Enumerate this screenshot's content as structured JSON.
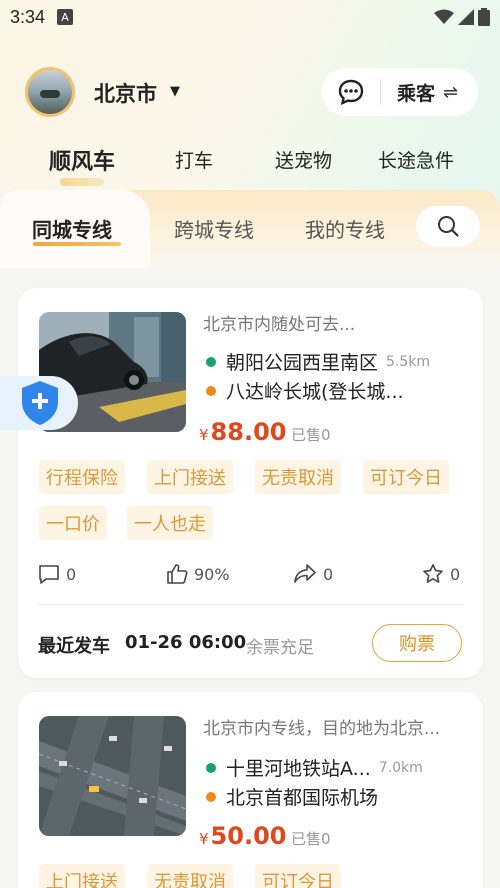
{
  "status_bar": {
    "time": "3:34",
    "a_label": "A"
  },
  "header": {
    "city": "北京市",
    "role": "乘客"
  },
  "main_tabs": [
    "顺风车",
    "打车",
    "送宠物",
    "长途急件"
  ],
  "sub_tabs": [
    "同城专线",
    "跨城专线",
    "我的专线"
  ],
  "cards": [
    {
      "title": "北京市内随处可去...",
      "from": "朝阳公园西里南区",
      "from_distance": "5.5km",
      "to": "八达岭长城(登长城...",
      "currency": "¥",
      "price": "88.00",
      "sold": "已售0",
      "tags": [
        "行程保险",
        "上门接送",
        "无责取消",
        "可订今日",
        "一口价",
        "一人也走"
      ],
      "comments": "0",
      "likes": "90%",
      "shares": "0",
      "favorites": "0",
      "depart_label": "最近发车",
      "depart_time": "01-26 06:00",
      "ticket_status": "余票充足",
      "buy_label": "购票"
    },
    {
      "title": "北京市内专线，目的地为北京...",
      "from": "十里河地铁站A...",
      "from_distance": "7.0km",
      "to": "北京首都国际机场",
      "currency": "¥",
      "price": "50.00",
      "sold": "已售0",
      "tags": [
        "上门接送",
        "无责取消",
        "可订今日"
      ]
    }
  ],
  "colors": {
    "price": "#e0471e",
    "tag_text": "#d79a3a",
    "tag_bg": "#fdf4e3",
    "accent": "#f0a63c",
    "from_dot": "#17a36b",
    "to_dot": "#f08a1e"
  }
}
